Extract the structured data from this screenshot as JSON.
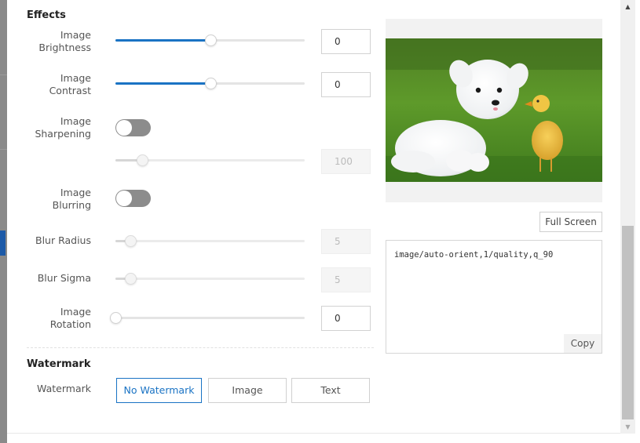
{
  "effects": {
    "title": "Effects",
    "brightness": {
      "label_line1": "Image",
      "label_line2": "Brightness",
      "value": "0",
      "level": 0.5
    },
    "contrast": {
      "label_line1": "Image",
      "label_line2": "Contrast",
      "value": "0",
      "level": 0.5
    },
    "sharpening": {
      "label_line1": "Image",
      "label_line2": "Sharpening",
      "enabled": false,
      "value": "100",
      "level": 0.14
    },
    "blurring": {
      "label_line1": "Image",
      "label_line2": "Blurring",
      "enabled": false
    },
    "blur_radius": {
      "label": "Blur Radius",
      "value": "5",
      "level": 0.08
    },
    "blur_sigma": {
      "label": "Blur Sigma",
      "value": "5",
      "level": 0.08
    },
    "rotation": {
      "label_line1": "Image",
      "label_line2": "Rotation",
      "value": "0",
      "level": 0.0
    }
  },
  "watermark": {
    "title": "Watermark",
    "label": "Watermark",
    "options": [
      "No Watermark",
      "Image",
      "Text"
    ],
    "selected": "No Watermark"
  },
  "preview": {
    "full_screen_label": "Full Screen",
    "code": "image/auto-orient,1/quality,q_90",
    "copy_label": "Copy"
  },
  "colors": {
    "accent": "#1a73c4",
    "toggle_off": "#8c8c8c"
  }
}
